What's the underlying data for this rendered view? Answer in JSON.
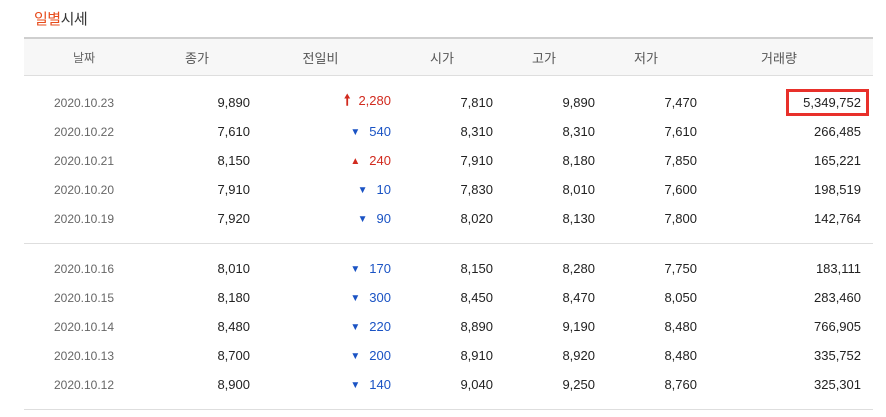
{
  "section": {
    "title_accent": "일별",
    "title_rest": "시세"
  },
  "colors": {
    "accent": "#e74c1c",
    "up": "#d12a1e",
    "down": "#1a53c4",
    "highlight_border": "#e8302a"
  },
  "headers": {
    "date": "날짜",
    "close": "종가",
    "diff": "전일비",
    "open": "시가",
    "high": "고가",
    "low": "저가",
    "volume": "거래량"
  },
  "groups": [
    [
      {
        "date": "2020.10.23",
        "close": "9,890",
        "dir": "up",
        "icon": "bold-up-arrow-icon",
        "arrow": "🠕",
        "diff": "2,280",
        "open": "7,810",
        "high": "9,890",
        "low": "7,470",
        "volume": "5,349,752",
        "highlighted": true
      },
      {
        "date": "2020.10.22",
        "close": "7,610",
        "dir": "down",
        "icon": "down-triangle-icon",
        "arrow": "▼",
        "diff": "540",
        "open": "8,310",
        "high": "8,310",
        "low": "7,610",
        "volume": "266,485"
      },
      {
        "date": "2020.10.21",
        "close": "8,150",
        "dir": "up",
        "icon": "up-triangle-icon",
        "arrow": "▲",
        "diff": "240",
        "open": "7,910",
        "high": "8,180",
        "low": "7,850",
        "volume": "165,221"
      },
      {
        "date": "2020.10.20",
        "close": "7,910",
        "dir": "down",
        "icon": "down-triangle-icon",
        "arrow": "▼",
        "diff": "10",
        "open": "7,830",
        "high": "8,010",
        "low": "7,600",
        "volume": "198,519"
      },
      {
        "date": "2020.10.19",
        "close": "7,920",
        "dir": "down",
        "icon": "down-triangle-icon",
        "arrow": "▼",
        "diff": "90",
        "open": "8,020",
        "high": "8,130",
        "low": "7,800",
        "volume": "142,764"
      }
    ],
    [
      {
        "date": "2020.10.16",
        "close": "8,010",
        "dir": "down",
        "icon": "down-triangle-icon",
        "arrow": "▼",
        "diff": "170",
        "open": "8,150",
        "high": "8,280",
        "low": "7,750",
        "volume": "183,111"
      },
      {
        "date": "2020.10.15",
        "close": "8,180",
        "dir": "down",
        "icon": "down-triangle-icon",
        "arrow": "▼",
        "diff": "300",
        "open": "8,450",
        "high": "8,470",
        "low": "8,050",
        "volume": "283,460"
      },
      {
        "date": "2020.10.14",
        "close": "8,480",
        "dir": "down",
        "icon": "down-triangle-icon",
        "arrow": "▼",
        "diff": "220",
        "open": "8,890",
        "high": "9,190",
        "low": "8,480",
        "volume": "766,905"
      },
      {
        "date": "2020.10.13",
        "close": "8,700",
        "dir": "down",
        "icon": "down-triangle-icon",
        "arrow": "▼",
        "diff": "200",
        "open": "8,910",
        "high": "8,920",
        "low": "8,480",
        "volume": "335,752"
      },
      {
        "date": "2020.10.12",
        "close": "8,900",
        "dir": "down",
        "icon": "down-triangle-icon",
        "arrow": "▼",
        "diff": "140",
        "open": "9,040",
        "high": "9,250",
        "low": "8,760",
        "volume": "325,301"
      }
    ]
  ]
}
